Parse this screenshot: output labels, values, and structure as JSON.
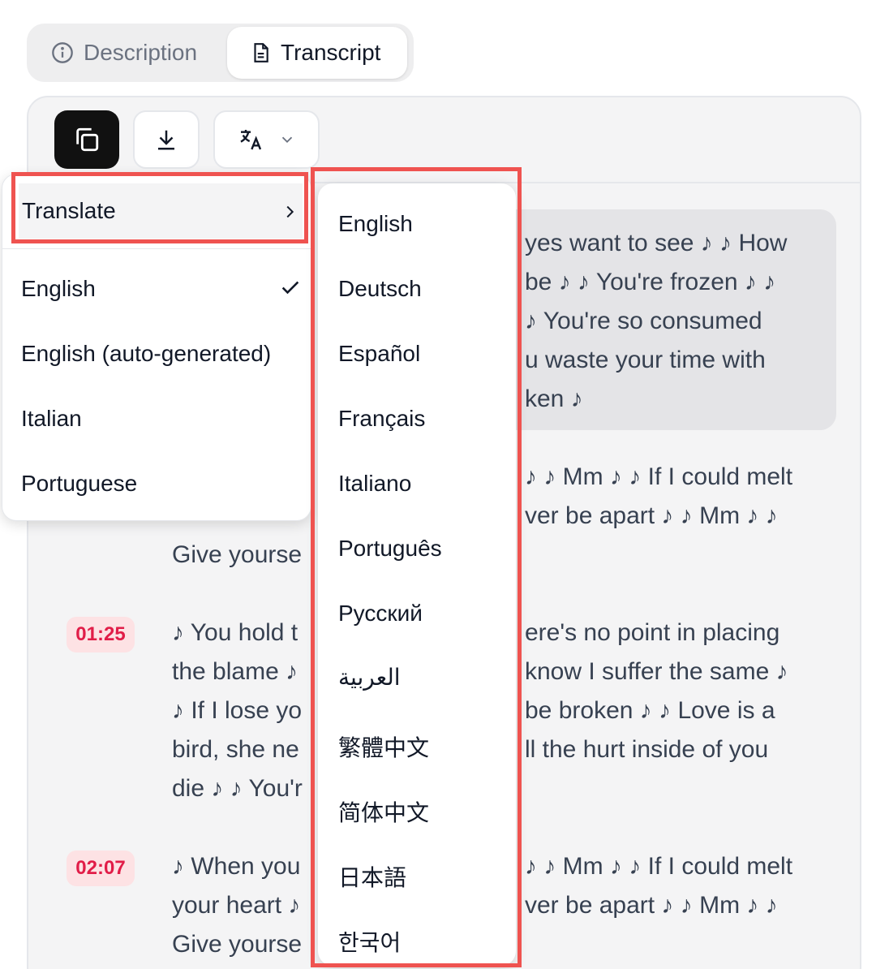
{
  "tabs": [
    {
      "label": "Description",
      "icon": "info-icon"
    },
    {
      "label": "Transcript",
      "icon": "document-icon"
    }
  ],
  "highlight": {
    "lines": [
      "yes want to see ♪ ♪ How",
      "be ♪ ♪ You're frozen ♪ ♪",
      "♪ You're so consumed",
      "u waste your time with",
      "ken ♪"
    ]
  },
  "segments": [
    {
      "left_lines": [
        "Give yourse"
      ],
      "right_lines": [
        "♪ ♪ Mm ♪ ♪ If I could melt",
        "ver be apart ♪ ♪ Mm ♪ ♪"
      ]
    },
    {
      "time": "01:25",
      "left_lines": [
        "♪ You hold t",
        "the blame ♪",
        "♪ If I lose yo",
        "bird, she ne",
        "die ♪ ♪ You'r"
      ],
      "right_lines": [
        "ere's no point in placing",
        "know I suffer the same ♪",
        "be broken ♪ ♪ Love is a",
        "ll the hurt inside of you"
      ]
    },
    {
      "time": "02:07",
      "left_lines": [
        "♪ When you",
        "your heart ♪",
        "Give yourse"
      ],
      "right_lines": [
        "♪ ♪ Mm ♪ ♪ If I could melt",
        "ver be apart ♪ ♪ Mm ♪ ♪"
      ]
    }
  ],
  "menu": {
    "translate_label": "Translate",
    "items": [
      "English",
      "English (auto-generated)",
      "Italian",
      "Portuguese"
    ],
    "selected": "English"
  },
  "submenu": {
    "languages": [
      "English",
      "Deutsch",
      "Español",
      "Français",
      "Italiano",
      "Português",
      "Русский",
      "العربية",
      "繁體中文",
      "简体中文",
      "日本語",
      "한국어"
    ]
  },
  "colors": {
    "accent_highlight": "#ef5350",
    "timestamp_bg": "#fde2e4",
    "timestamp_text": "#e11d48"
  }
}
